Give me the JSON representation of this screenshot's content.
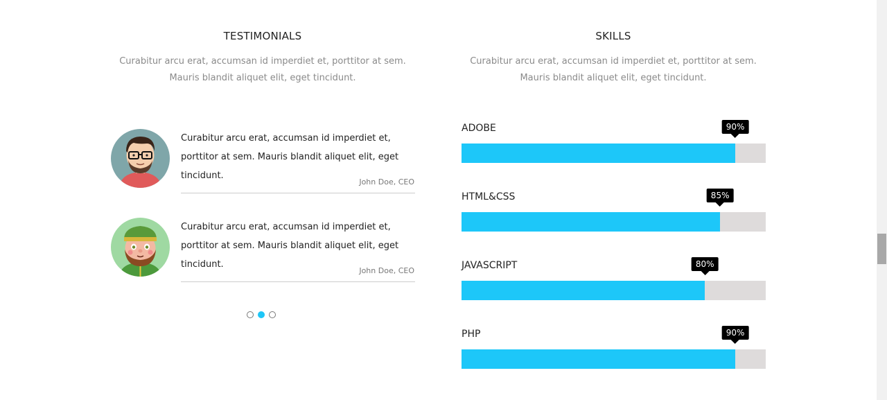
{
  "testimonials": {
    "title": "TESTIMONIALS",
    "subtitle_line1": "Curabitur arcu erat, accumsan id imperdiet et, porttitor at sem.",
    "subtitle_line2": "Mauris blandit aliquet elit, eget tincidunt.",
    "items": [
      {
        "avatar": "man-with-glasses-avatar",
        "quote": "Curabitur arcu erat, accumsan id imperdiet et, porttitor at sem. Mauris blandit aliquet elit, eget tincidunt.",
        "author": "John Doe, CEO"
      },
      {
        "avatar": "bearded-man-green-hat-avatar",
        "quote": "Curabitur arcu erat, accumsan id imperdiet et, porttitor at sem. Mauris blandit aliquet elit, eget tincidunt.",
        "author": "John Doe, CEO"
      }
    ],
    "pagination": {
      "count": 3,
      "active": 2
    }
  },
  "skills": {
    "title": "SKILLS",
    "subtitle_line1": "Curabitur arcu erat, accumsan id imperdiet et, porttitor at sem.",
    "subtitle_line2": "Mauris blandit aliquet elit, eget tincidunt.",
    "items": [
      {
        "name": "ADOBE",
        "percent": 90,
        "label": "90%"
      },
      {
        "name": "HTML&CSS",
        "percent": 85,
        "label": "85%"
      },
      {
        "name": "JAVASCRIPT",
        "percent": 80,
        "label": "80%"
      },
      {
        "name": "PHP",
        "percent": 90,
        "label": "90%"
      }
    ]
  },
  "colors": {
    "accent": "#1dc7f9",
    "track": "#dedbdb",
    "tooltip": "#000000"
  }
}
